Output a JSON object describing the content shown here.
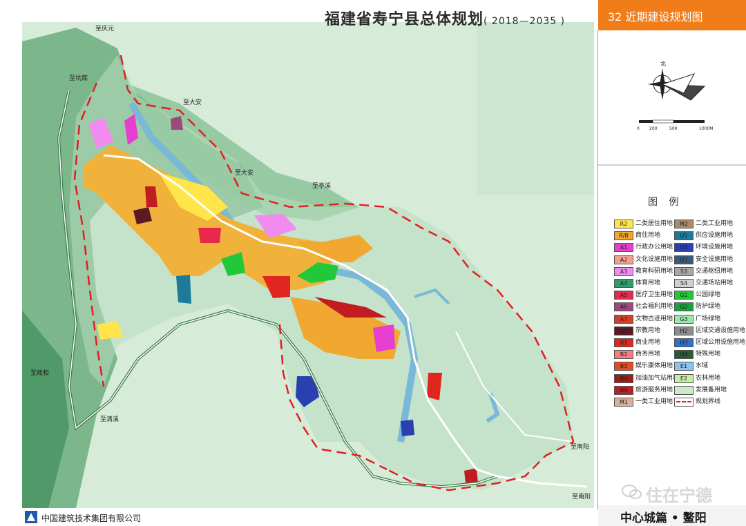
{
  "header": {
    "title": "福建省寿宁县总体规划",
    "title_years": "( 2018—2035 )",
    "sheet_label": "32  近期建设规划图"
  },
  "north_arrow": {
    "label": "北"
  },
  "scale": {
    "ticks": [
      "0",
      "200",
      "500",
      "1000M"
    ]
  },
  "legend": {
    "title": "图  例",
    "left": [
      {
        "code": "R2",
        "label": "二类居住用地",
        "color": "#ffe54a"
      },
      {
        "code": "R/B",
        "label": "商住用地",
        "color": "#f0a830"
      },
      {
        "code": "A1",
        "label": "行政办公用地",
        "color": "#e63ecf"
      },
      {
        "code": "A2",
        "label": "文化设施用地",
        "color": "#f3a090"
      },
      {
        "code": "A3",
        "label": "教育科研用地",
        "color": "#f08cf0"
      },
      {
        "code": "A4",
        "label": "体育用地",
        "color": "#2e9e6e"
      },
      {
        "code": "A5",
        "label": "医疗卫生用地",
        "color": "#e8284c"
      },
      {
        "code": "A6",
        "label": "社会福利用地",
        "color": "#9c4a7c"
      },
      {
        "code": "A7",
        "label": "文物古迹用地",
        "color": "#d0402a"
      },
      {
        "code": "A9",
        "label": "宗教用地",
        "color": "#5c1a24"
      },
      {
        "code": "B1",
        "label": "商业用地",
        "color": "#e0261e"
      },
      {
        "code": "B2",
        "label": "商务用地",
        "color": "#f08080"
      },
      {
        "code": "B3",
        "label": "娱乐康体用地",
        "color": "#e84c1c"
      },
      {
        "code": "B4",
        "label": "加油加气站用地",
        "color": "#a01c1c"
      },
      {
        "code": "B9",
        "label": "旅游服务用地",
        "color": "#c01c22"
      },
      {
        "code": "M1",
        "label": "一类工业用地",
        "color": "#d8b096"
      }
    ],
    "right": [
      {
        "code": "M2",
        "label": "二类工业用地",
        "color": "#a88a70"
      },
      {
        "code": "U1",
        "label": "供应设施用地",
        "color": "#1e7a9a"
      },
      {
        "code": "U2",
        "label": "环境设施用地",
        "color": "#2a3fb0"
      },
      {
        "code": "U3",
        "label": "安全设施用地",
        "color": "#3a5a7a"
      },
      {
        "code": "S3",
        "label": "交通枢纽用地",
        "color": "#a8a8a8"
      },
      {
        "code": "S4",
        "label": "交通场站用地",
        "color": "#d0d0d0"
      },
      {
        "code": "G1",
        "label": "公园绿地",
        "color": "#22c83a"
      },
      {
        "code": "G2",
        "label": "防护绿地",
        "color": "#17a23a"
      },
      {
        "code": "G3",
        "label": "广场绿地",
        "color": "#9ee6b0"
      },
      {
        "code": "H2",
        "label": "区域交通设施用地",
        "color": "#8c8c8c"
      },
      {
        "code": "H3",
        "label": "区域公用设施用地",
        "color": "#3070c8"
      },
      {
        "code": "H4",
        "label": "特殊用地",
        "color": "#2a5a3a"
      },
      {
        "code": "E1",
        "label": "水域",
        "color": "#8cc4ee"
      },
      {
        "code": "E2",
        "label": "农林用地",
        "color": "#c8eea6"
      },
      {
        "code": "",
        "label": "发展备用地",
        "color": "#cfe8c8"
      },
      {
        "code": "",
        "label": "规划界线",
        "color": "#e02020"
      }
    ]
  },
  "map_labels": {
    "qingyuan": "至庆元",
    "kengdi": "至坑底",
    "dadan1": "至大安",
    "dadan2": "至大安",
    "tingxi": "至亭溪",
    "zhenghe": "至政和",
    "qingxi": "至清溪",
    "nanyang1": "至南阳",
    "nanyang2": "至南阳"
  },
  "branding": {
    "wechat": "住在宁德",
    "district": "中心城篇 • 鳌阳",
    "company": "中国建筑技术集团有限公司"
  }
}
